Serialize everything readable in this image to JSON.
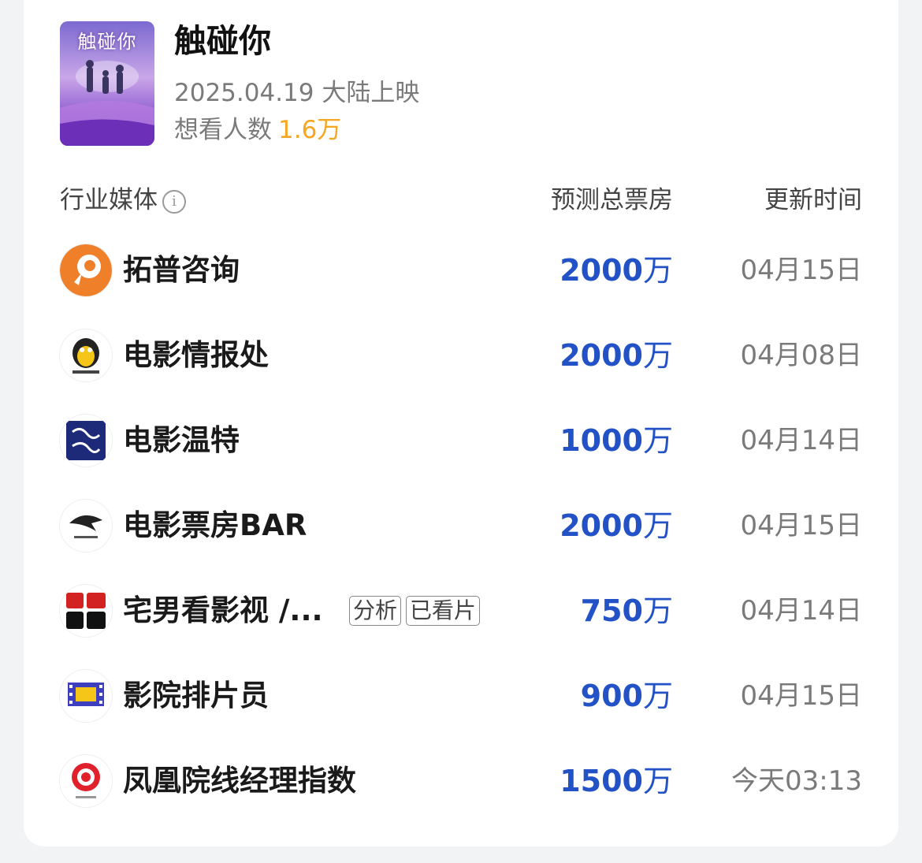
{
  "movie": {
    "poster_text": "触碰你",
    "title": "触碰你",
    "release": "2025.04.19 大陆上映",
    "wish_label": "想看人数",
    "wish_value": "1.6万"
  },
  "table": {
    "header_media": "行业媒体",
    "header_info_icon": "i",
    "header_boxoffice": "预测总票房",
    "header_time": "更新时间"
  },
  "rows": [
    {
      "name": "拓普咨询",
      "value": "2000",
      "unit": "万",
      "time": "04月15日",
      "icon": "topu-logo-icon",
      "accent": "#f07f2a"
    },
    {
      "name": "电影情报处",
      "value": "2000",
      "unit": "万",
      "time": "04月08日",
      "icon": "penguin-logo-icon",
      "accent": "#f5c518"
    },
    {
      "name": "电影温特",
      "value": "1000",
      "unit": "万",
      "time": "04月14日",
      "icon": "wente-logo-icon",
      "accent": "#1d2a7a"
    },
    {
      "name": "电影票房BAR",
      "value": "2000",
      "unit": "万",
      "time": "04月15日",
      "icon": "bar-logo-icon",
      "accent": "#222222"
    },
    {
      "name": "宅男看影视 /...",
      "tags": [
        "分析",
        "已看片"
      ],
      "value": "750",
      "unit": "万",
      "time": "04月14日",
      "icon": "zhainan-logo-icon",
      "accent": "#d22222"
    },
    {
      "name": "影院排片员",
      "value": "900",
      "unit": "万",
      "time": "04月15日",
      "icon": "film-logo-icon",
      "accent": "#3d3fbf"
    },
    {
      "name": "凤凰院线经理指数",
      "value": "1500",
      "unit": "万",
      "time": "今天03:13",
      "icon": "ifeng-logo-icon",
      "accent": "#e0202a"
    }
  ]
}
